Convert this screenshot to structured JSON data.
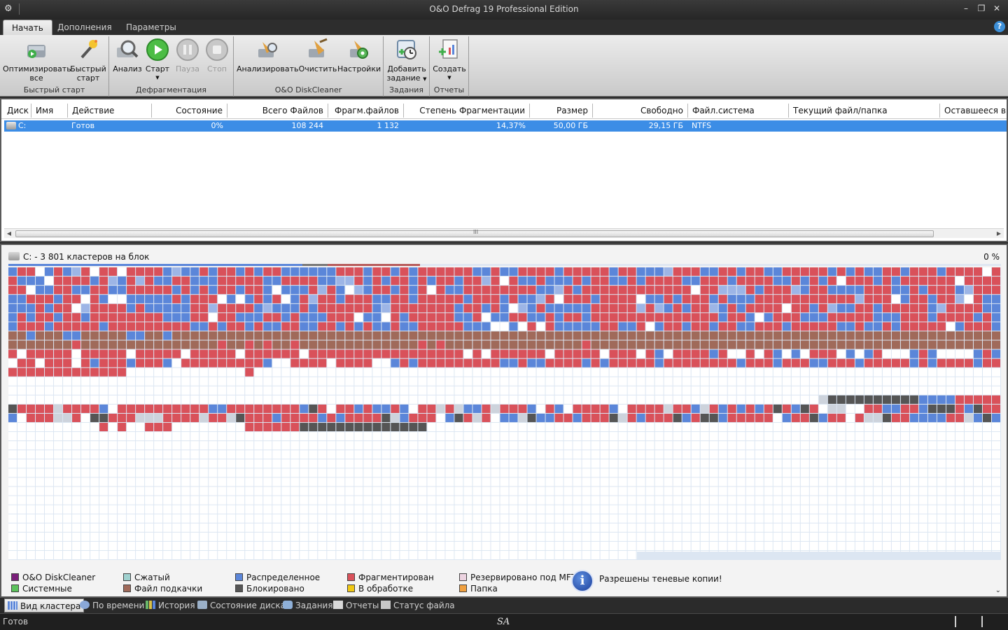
{
  "window": {
    "title": "O&O Defrag 19 Professional Edition"
  },
  "tabs": [
    {
      "label": "Начать",
      "active": true
    },
    {
      "label": "Дополнения",
      "active": false
    },
    {
      "label": "Параметры",
      "active": false
    }
  ],
  "ribbon": {
    "groups": [
      {
        "title": "Быстрый старт",
        "buttons": [
          {
            "label": "Оптимизировать\nвсе",
            "icon": "optimize-all-icon",
            "enabled": true
          },
          {
            "label": "Быстрый\nстарт",
            "icon": "wand-icon",
            "enabled": true
          }
        ]
      },
      {
        "title": "Дефрагментация",
        "buttons": [
          {
            "label": "Анализ",
            "icon": "magnifier-icon",
            "enabled": true
          },
          {
            "label": "Старт",
            "icon": "play-icon",
            "enabled": true,
            "dropdown": true
          },
          {
            "label": "Пауза",
            "icon": "pause-icon",
            "enabled": false
          },
          {
            "label": "Стоп",
            "icon": "stop-icon",
            "enabled": false
          }
        ]
      },
      {
        "title": "O&O DiskCleaner",
        "buttons": [
          {
            "label": "Анализировать",
            "icon": "analyze-broom-icon",
            "enabled": true
          },
          {
            "label": "Очистить",
            "icon": "broom-icon",
            "enabled": true
          },
          {
            "label": "Настройки",
            "icon": "settings-broom-icon",
            "enabled": true
          }
        ]
      },
      {
        "title": "Задания",
        "buttons": [
          {
            "label": "Добавить\nзадание",
            "icon": "add-task-icon",
            "enabled": true,
            "dropdown": true
          }
        ]
      },
      {
        "title": "Отчеты",
        "buttons": [
          {
            "label": "Создать",
            "icon": "report-icon",
            "enabled": true,
            "dropdown": true
          }
        ]
      }
    ]
  },
  "drive_list": {
    "columns": [
      "Диск",
      "Имя",
      "Действие",
      "Состояние",
      "Всего Файлов",
      "Фрагм.файлов",
      "Степень Фрагментации",
      "Размер",
      "Свободно",
      "Файл.система",
      "Текущий файл/папка",
      "Оставшееся время"
    ],
    "rows": [
      {
        "disk": "C:",
        "name": "",
        "action": "Готов",
        "state": "0%",
        "total_files": "108 244",
        "frag_files": "1 132",
        "frag_degree": "14,37%",
        "size": "50,00 ГБ",
        "free": "29,15 ГБ",
        "fs": "NTFS",
        "current": "",
        "remaining": ""
      }
    ],
    "scroll_grip": "III"
  },
  "cluster_map": {
    "title": "C: - 3 801 кластеров на блок",
    "percent": "0 %"
  },
  "legend": {
    "items": [
      {
        "label": "O&O DiskCleaner",
        "color": "#7a1f7a"
      },
      {
        "label": "Системные",
        "color": "#5cc25c"
      },
      {
        "label": "Сжатый",
        "color": "#9fd1cf"
      },
      {
        "label": "Файл подкачки",
        "color": "#a06a5a"
      },
      {
        "label": "Распределенное",
        "color": "#5b86d9"
      },
      {
        "label": "Блокировано",
        "color": "#555555"
      },
      {
        "label": "Фрагментирован",
        "color": "#d9515a"
      },
      {
        "label": "В обработке",
        "color": "#f0c814"
      },
      {
        "label": "Резервировано под MFT",
        "color": "#ecd3e0"
      },
      {
        "label": "Папка",
        "color": "#f0a040"
      }
    ],
    "info_text": "Разрешены теневые копии!",
    "info_icon_glyph": "i"
  },
  "view_tabs": [
    {
      "label": "Вид кластера",
      "active": true
    },
    {
      "label": "По времени",
      "active": false
    },
    {
      "label": "История",
      "active": false
    },
    {
      "label": "Состояние диска",
      "active": false
    },
    {
      "label": "Задания",
      "active": false
    },
    {
      "label": "Отчеты",
      "active": false
    },
    {
      "label": "Статус файла",
      "active": false
    }
  ],
  "status": {
    "text": "Готов",
    "watermark": "SA"
  },
  "colors": {
    "fragmented": "#d9515a",
    "allocated": "#5b86d9",
    "pagefile": "#a06a5a",
    "blocked": "#555555",
    "free": "#ffffff",
    "selection": "#3c8de6"
  }
}
